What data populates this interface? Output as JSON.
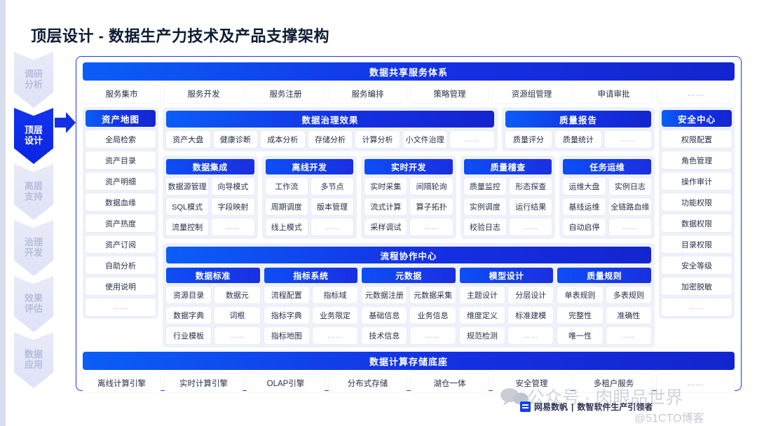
{
  "page_title": "顶层设计 - 数据生产力技术及产品支撑架构",
  "rail": {
    "steps": [
      {
        "line1": "调研",
        "line2": "分析",
        "active": false
      },
      {
        "line1": "顶层",
        "line2": "设计",
        "active": true
      },
      {
        "line1": "高层",
        "line2": "支持",
        "active": false
      },
      {
        "line1": "治理",
        "line2": "开发",
        "active": false
      },
      {
        "line1": "效果",
        "line2": "评估",
        "active": false
      },
      {
        "line1": "数据",
        "line2": "应用",
        "active": false
      }
    ]
  },
  "top_band": {
    "title": "数据共享服务体系",
    "items": [
      "服务集市",
      "服务开发",
      "服务注册",
      "服务编排",
      "策略管理",
      "资源组管理",
      "申请审批",
      "……"
    ]
  },
  "asset_map": {
    "title": "资产地图",
    "items": [
      "全局检索",
      "资产目录",
      "资产明细",
      "数据血缘",
      "资产热度",
      "资产订阅",
      "自助分析",
      "使用说明",
      "……"
    ]
  },
  "governance": {
    "title": "数据治理效果",
    "items": [
      "资产大盘",
      "健康诊断",
      "成本分析",
      "存储分析",
      "计算分析",
      "小文件治理",
      "……"
    ]
  },
  "quality_report": {
    "title": "质量报告",
    "items": [
      "质量评分",
      "质量统计",
      "……"
    ]
  },
  "security_center": {
    "title": "安全中心",
    "items": [
      "权限配置",
      "角色管理",
      "操作审计",
      "功能权限",
      "数据权限",
      "目录权限",
      "安全等级",
      "加密脱敏",
      "……"
    ]
  },
  "dev_groups": [
    {
      "title": "数据集成",
      "items": [
        "数据源管理",
        "向导模式",
        "SQL模式",
        "字段映射",
        "流量控制",
        "……"
      ]
    },
    {
      "title": "离线开发",
      "items": [
        "工作流",
        "多节点",
        "周期调度",
        "版本管理",
        "线上模式",
        "……"
      ]
    },
    {
      "title": "实时开发",
      "items": [
        "实时采集",
        "间隔轮询",
        "流式计算",
        "算子拓扑",
        "采样调试",
        "……"
      ]
    },
    {
      "title": "质量稽查",
      "items": [
        "质量监控",
        "形态探查",
        "实例调度",
        "运行结果",
        "校验日志",
        "……"
      ]
    },
    {
      "title": "任务运维",
      "items": [
        "运维大盘",
        "实例日志",
        "基线运维",
        "全链路血缘",
        "自动启停",
        "……"
      ]
    }
  ],
  "flow_center": {
    "title": "流程协作中心",
    "groups": [
      {
        "title": "数据标准",
        "items": [
          "资源目录",
          "数据元",
          "数据字典",
          "词根",
          "行业模板",
          "……"
        ]
      },
      {
        "title": "指标系统",
        "items": [
          "流程配置",
          "指标域",
          "指标字典",
          "业务限定",
          "指标地图",
          "……"
        ]
      },
      {
        "title": "元数据",
        "items": [
          "元数据注册",
          "元数据采集",
          "基础信息",
          "业务信息",
          "技术信息",
          "……"
        ]
      },
      {
        "title": "模型设计",
        "items": [
          "主题设计",
          "分层设计",
          "维度定义",
          "标准建模",
          "规范检测",
          "……"
        ]
      },
      {
        "title": "质量规则",
        "items": [
          "单表规则",
          "多表规则",
          "完整性",
          "准确性",
          "唯一性",
          "……"
        ]
      }
    ]
  },
  "bottom_band": {
    "title": "数据计算存储底座",
    "items": [
      "离线计算引擎",
      "实时计算引擎",
      "OLAP引擎",
      "分布式存储",
      "湖仓一体",
      "安全管理",
      "多租户服务",
      "……"
    ]
  },
  "footer": {
    "brand": "网易数帆",
    "separator": "|",
    "tagline": "数智软件生产引领者"
  },
  "watermark": {
    "main": "公众号 · 肉眼品世界",
    "secondary": "@51CTO博客"
  },
  "colors": {
    "accent": "#1430e3",
    "accent_light": "#0b5ef7",
    "panel_border": "#2238e8",
    "chip_bg": "#ffffff",
    "group_bg": "#eef1fb"
  }
}
